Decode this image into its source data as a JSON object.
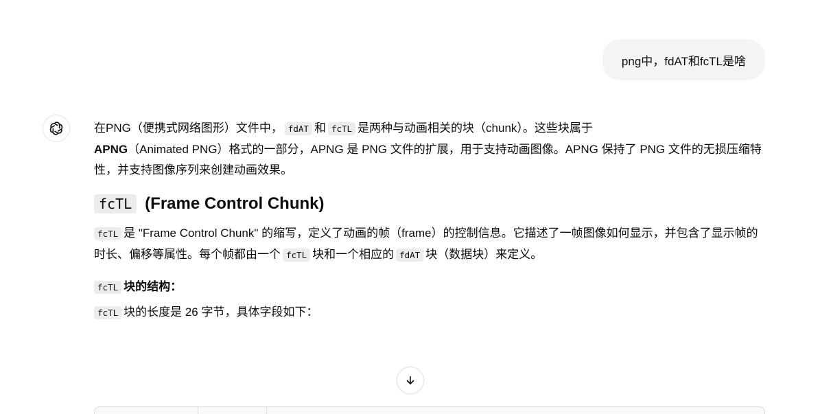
{
  "user_message": "png中，fdAT和fcTL是啥",
  "assistant": {
    "avatar_icon": "openai-logo-icon",
    "intro": {
      "t1": "在PNG（便携式网络图形）文件中，",
      "c1": "fdAT",
      "t2": "和",
      "c2": "fcTL",
      "t3": "是两种与动画相关的块（chunk）。这些块属于",
      "bold": "APNG",
      "t4": "（Animated PNG）格式的一部分，APNG 是 PNG 文件的扩展，用于支持动画图像。APNG 保持了 PNG 文件的无损压缩特性，并支持图像序列来创建动画效果。"
    },
    "heading": {
      "code": "fcTL",
      "text": "(Frame Control Chunk)"
    },
    "para2": {
      "c1": "fcTL",
      "t1": "是 \"Frame Control Chunk\" 的缩写，定义了动画的帧（frame）的控制信息。它描述了一帧图像如何显示，并包含了显示帧的时长、偏移等属性。每个帧都由一个",
      "c2": "fcTL",
      "t2": "块和一个相应的",
      "c3": "fdAT",
      "t3": "块（数据块）来定义。"
    },
    "struct_heading": {
      "code": "fcTL",
      "text": "块的结构："
    },
    "struct_text": {
      "code": "fcTL",
      "text": "块的长度是 26 字节，具体字段如下："
    }
  },
  "scroll_button_icon": "arrow-down-icon"
}
